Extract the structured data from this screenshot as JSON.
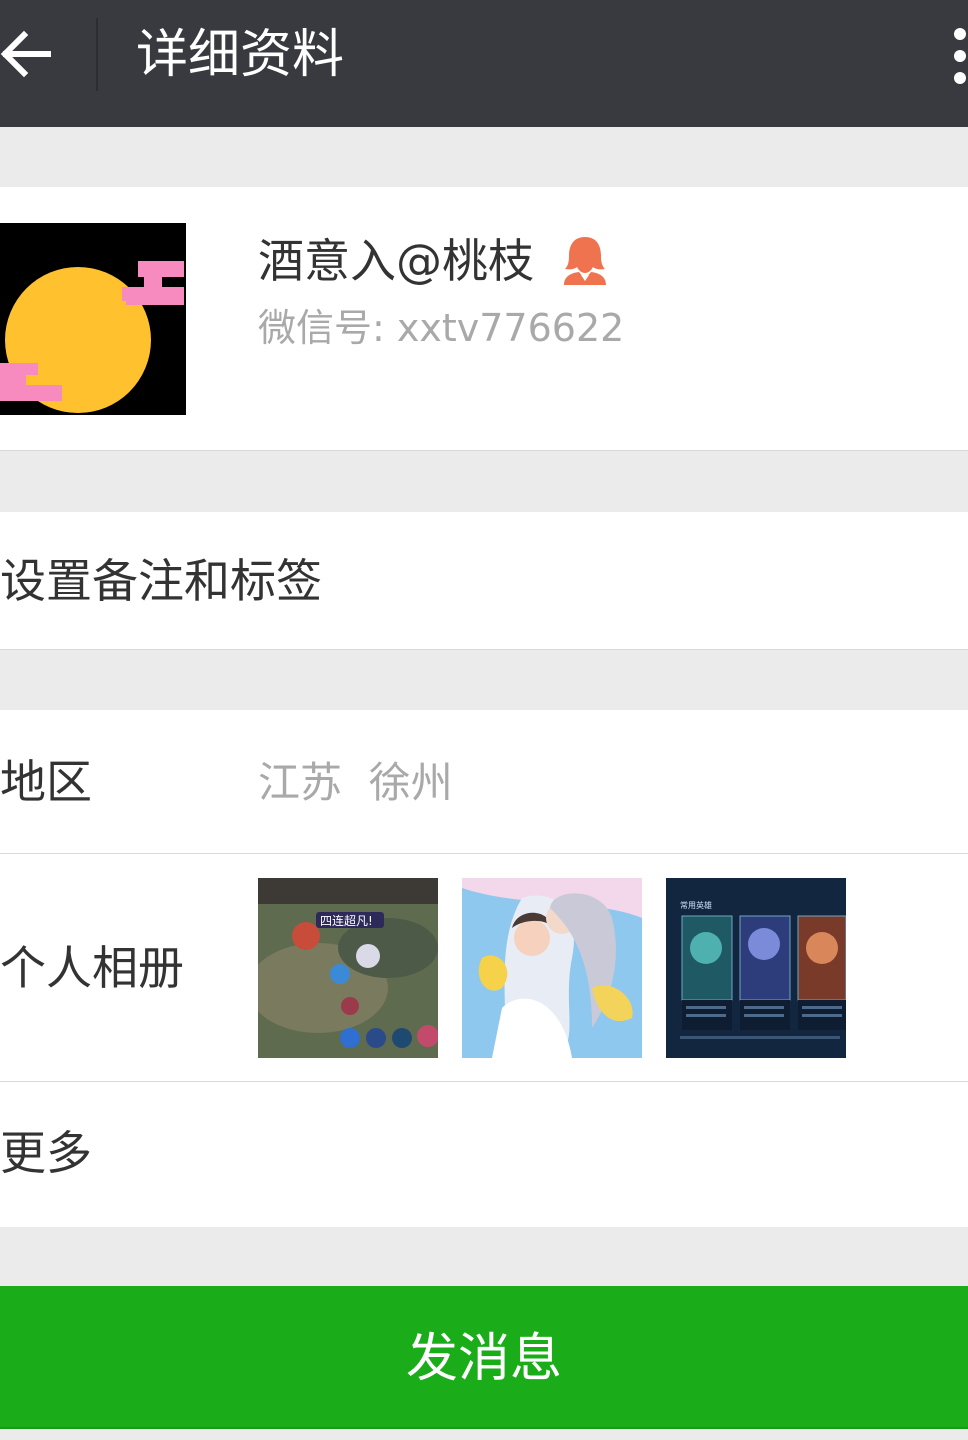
{
  "header": {
    "back_icon": "arrow-left-icon",
    "title": "详细资料",
    "more_icon": "more-vertical-icon"
  },
  "profile": {
    "nickname": "酒意入@桃枝",
    "gender_icon": "female-user-icon",
    "wechat_id": "微信号: xxtv776622"
  },
  "remark": {
    "label": "设置备注和标签"
  },
  "region": {
    "label": "地区",
    "value": "江苏  徐州"
  },
  "album": {
    "label": "个人相册",
    "thumb1_caption": "四连超凡!",
    "thumb3_caption": "常用英雄"
  },
  "more": {
    "label": "更多"
  },
  "send_button": {
    "label": "发消息"
  },
  "colors": {
    "topbar": "#393a3f",
    "primary_green": "#1aad19",
    "gender_icon": "#f0734f",
    "background": "#ebebeb"
  }
}
